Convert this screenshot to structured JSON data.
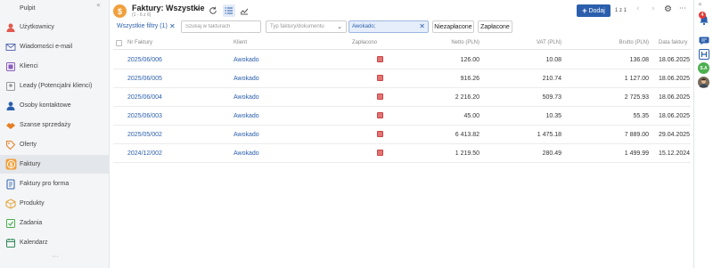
{
  "sidebar": {
    "collapse_glyph": "«",
    "more_glyph": "···",
    "items": [
      {
        "label": "Pulpit",
        "icon": "dashboard-icon"
      },
      {
        "label": "Użytkownicy",
        "icon": "user-icon"
      },
      {
        "label": "Wiadomości e-mail",
        "icon": "mail-icon"
      },
      {
        "label": "Klienci",
        "icon": "client-icon"
      },
      {
        "label": "Leady (Potencjalni klienci)",
        "icon": "lead-icon"
      },
      {
        "label": "Osoby kontaktowe",
        "icon": "contact-icon"
      },
      {
        "label": "Szanse sprzedaży",
        "icon": "handshake-icon"
      },
      {
        "label": "Oferty",
        "icon": "offer-tag-icon"
      },
      {
        "label": "Faktury",
        "icon": "invoice-coin-icon",
        "active": true
      },
      {
        "label": "Faktury pro forma",
        "icon": "proforma-icon"
      },
      {
        "label": "Produkty",
        "icon": "product-box-icon"
      },
      {
        "label": "Zadania",
        "icon": "task-check-icon"
      },
      {
        "label": "Kalendarz",
        "icon": "calendar-icon"
      }
    ]
  },
  "header": {
    "icon_glyph": "$",
    "title": "Faktury: Wszystkie",
    "caret": "⌄",
    "subtitle": "(1 - 6 z 6)",
    "add_plus": "+",
    "add_label": "Dodaj",
    "pager": "1 z 1",
    "prev_glyph": "‹",
    "next_glyph": "›",
    "gear_glyph": "⚙",
    "dots_glyph": "···"
  },
  "filters": {
    "all_filters": "Wszystkie filtry (1)",
    "clear_glyph": "✕",
    "search_placeholder": "Szukaj w fakturach",
    "type_placeholder": "Typ faktury/dokumentu",
    "type_caret": "⌄",
    "client_filter": "Awokado;",
    "client_clear": "✕",
    "unpaid": "Niezapłacone",
    "paid": "Zapłacone"
  },
  "table": {
    "columns": {
      "number": "Nr Faktury",
      "client": "Klient",
      "paid": "Zapłacono",
      "net": "Netto (PLN)",
      "vat": "VAT (PLN)",
      "gross": "Brutto (PLN)",
      "date": "Data faktury"
    },
    "rows": [
      {
        "number": "2025/06/006",
        "client": "Awokado",
        "paid": false,
        "net": "126.00",
        "vat": "10.08",
        "gross": "136.08",
        "date": "18.06.2025"
      },
      {
        "number": "2025/06/005",
        "client": "Awokado",
        "paid": false,
        "net": "916.26",
        "vat": "210.74",
        "gross": "1 127.00",
        "date": "18.06.2025"
      },
      {
        "number": "2025/06/004",
        "client": "Awokado",
        "paid": false,
        "net": "2 216.20",
        "vat": "509.73",
        "gross": "2 725.93",
        "date": "18.06.2025"
      },
      {
        "number": "2025/06/003",
        "client": "Awokado",
        "paid": false,
        "net": "45.00",
        "vat": "10.35",
        "gross": "55.35",
        "date": "18.06.2025"
      },
      {
        "number": "2025/05/002",
        "client": "Awokado",
        "paid": false,
        "net": "6 413.82",
        "vat": "1 475.18",
        "gross": "7 889.00",
        "date": "29.04.2025"
      },
      {
        "number": "2024/12/002",
        "client": "Awokado",
        "paid": false,
        "net": "1 219.50",
        "vat": "280.49",
        "gross": "1 499.99",
        "date": "15.12.2024"
      }
    ]
  },
  "rail": {
    "collapse_glyph": "«",
    "notification_count": "4",
    "chat_icon": "chat-icon",
    "board_icon": "board-icon",
    "user_initials": "S.A",
    "avatar": "avatar"
  },
  "colors": {
    "accent": "#2b5fad",
    "invoice_orange": "#f0a03c",
    "unpaid_red": "#e57373",
    "notification_red": "#e53935",
    "initials_green": "#4caf50"
  }
}
